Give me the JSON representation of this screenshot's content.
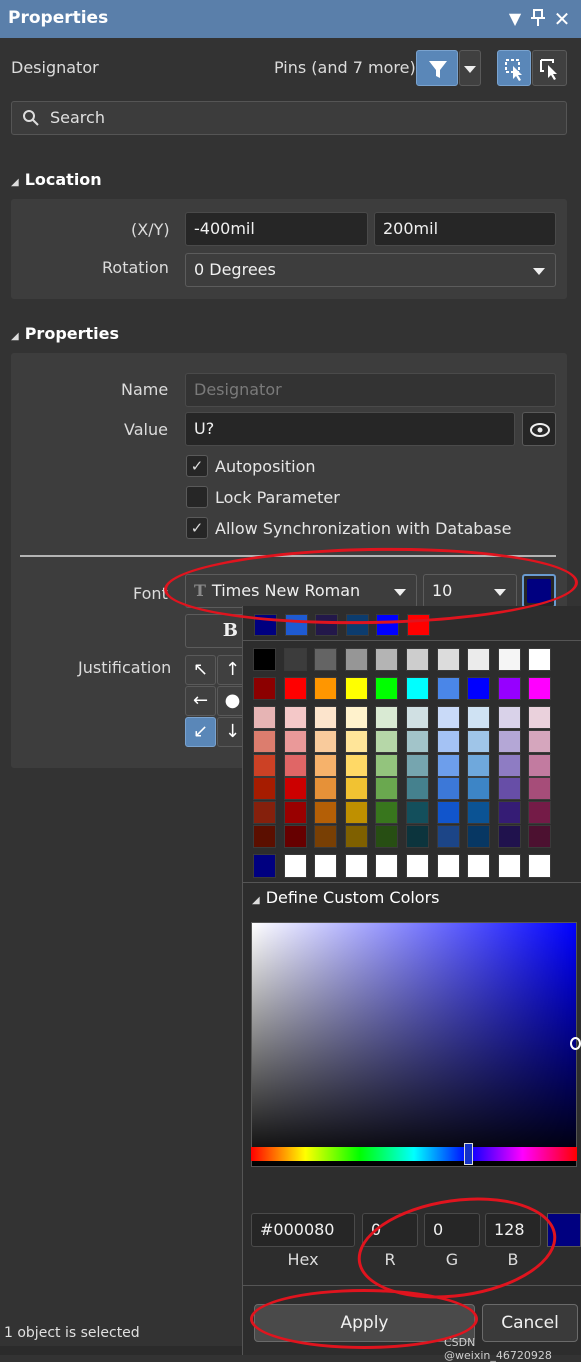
{
  "panel": {
    "title": "Properties"
  },
  "header": {
    "object_type": "Designator",
    "filter_text": "Pins (and 7 more)"
  },
  "search": {
    "placeholder": "Search"
  },
  "location": {
    "heading": "Location",
    "xy_label": "(X/Y)",
    "x_value": "-400mil",
    "y_value": "200mil",
    "rotation_label": "Rotation",
    "rotation_value": "0 Degrees"
  },
  "properties": {
    "heading": "Properties",
    "name_label": "Name",
    "name_placeholder": "Designator",
    "value_label": "Value",
    "value_value": "U?",
    "checkboxes": [
      {
        "label": "Autoposition",
        "checked": "✓"
      },
      {
        "label": "Lock Parameter",
        "checked": ""
      },
      {
        "label": "Allow Synchronization with Database",
        "checked": "✓"
      }
    ],
    "font_label": "Font",
    "font_family": "Times New Roman",
    "font_size": "10",
    "font_icon": "T",
    "bold_glyph": "B",
    "justification_label": "Justification",
    "font_color": "#000080"
  },
  "color_picker": {
    "recent_colors": [
      "#000080",
      "#1e5ad2",
      "#23184a",
      "#0c3c6e",
      "#0000ff",
      "#ff0000"
    ],
    "palette": [
      [
        "#000000",
        "#3c3c3c",
        "#646464",
        "#969696",
        "#b4b4b4",
        "#cdcdcd",
        "#dcdcdc",
        "#ebebeb",
        "#f5f5f5",
        "#ffffff"
      ],
      [
        "#8c0000",
        "#ff0000",
        "#ff9600",
        "#ffff00",
        "#00ff00",
        "#00ffff",
        "#4a86e8",
        "#0000ff",
        "#9600ff",
        "#ff00ff"
      ],
      [
        "#e6b4b4",
        "#f4c8c8",
        "#fce4cc",
        "#fff2cc",
        "#d9ead3",
        "#d0e0e3",
        "#c9daf8",
        "#cfe2f3",
        "#d9d2e9",
        "#ead1dc"
      ],
      [
        "#dc7d6e",
        "#ea9999",
        "#f9cb9c",
        "#ffe599",
        "#b6d7a8",
        "#a2c4c9",
        "#a4c2f4",
        "#9fc5e8",
        "#b4a7d6",
        "#d5a6bd"
      ],
      [
        "#cc4125",
        "#e06666",
        "#f6b26b",
        "#ffd966",
        "#93c47d",
        "#76a5af",
        "#6d9eeb",
        "#6fa8dc",
        "#8e7cc3",
        "#c27ba0"
      ],
      [
        "#a61c00",
        "#cc0000",
        "#e69138",
        "#f1c232",
        "#6aa84f",
        "#45818e",
        "#3c78d8",
        "#3d85c6",
        "#674ea7",
        "#a64d79"
      ],
      [
        "#85200c",
        "#990000",
        "#b45f06",
        "#bf9000",
        "#38761d",
        "#134f5c",
        "#1155cc",
        "#0b5394",
        "#351c75",
        "#741b47"
      ],
      [
        "#5b0f00",
        "#660000",
        "#783f04",
        "#7f6000",
        "#274e13",
        "#0c343d",
        "#1c4587",
        "#073763",
        "#20124d",
        "#4c1130"
      ]
    ],
    "custom_colors": [
      "#000080",
      "#ffffff",
      "#ffffff",
      "#ffffff",
      "#ffffff",
      "#ffffff",
      "#ffffff",
      "#ffffff",
      "#ffffff",
      "#ffffff"
    ],
    "define_heading": "Define Custom Colors",
    "hex_value": "#000080",
    "hex_caption": "Hex",
    "r_value": "0",
    "r_caption": "R",
    "g_value": "0",
    "g_caption": "G",
    "b_value": "128",
    "b_caption": "B",
    "hue_marker_fraction": 0.667,
    "apply_label": "Apply",
    "cancel_label": "Cancel"
  },
  "status": {
    "text": "1 object is selected",
    "watermark": "CSDN @weixin_46720928"
  }
}
